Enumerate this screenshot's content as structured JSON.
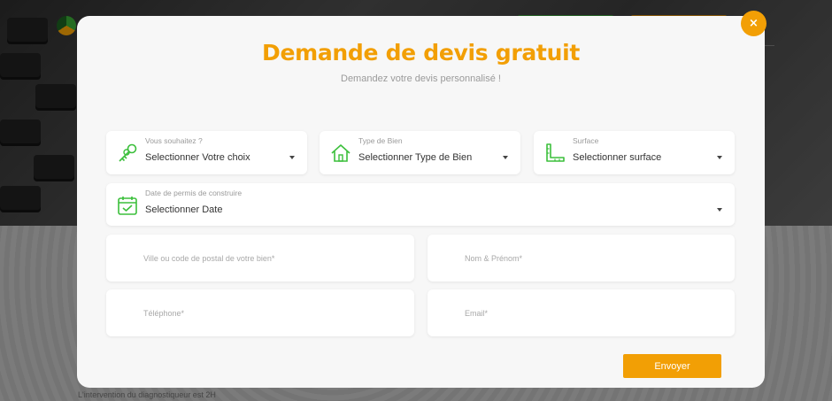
{
  "background": {
    "footer_text": "L'intervention du diagnostiqueur est 2H"
  },
  "modal": {
    "close_label": "×",
    "title": "Demande de devis gratuit",
    "subtitle": "Demandez votre devis personnalisé !",
    "selects": [
      {
        "id": "project",
        "label": "Vous souhaitez ?",
        "value": "Selectionner Votre choix",
        "icon": "keys-icon"
      },
      {
        "id": "property-type",
        "label": "Type de Bien",
        "value": "Selectionner Type de Bien",
        "icon": "house-icon"
      },
      {
        "id": "surface",
        "label": "Surface",
        "value": "Selectionner surface",
        "icon": "ruler-icon"
      },
      {
        "id": "permit-date",
        "label": "Date de permis de construire",
        "value": "Selectionner Date",
        "icon": "calendar-check-icon"
      }
    ],
    "inputs": {
      "city_placeholder": "Ville ou code de postal de votre bien*",
      "name_placeholder": "Nom & Prénom*",
      "phone_placeholder": "Téléphone*",
      "email_placeholder": "Email*"
    },
    "submit_label": "Envoyer"
  },
  "colors": {
    "accent": "#f29f05",
    "icon_green": "#3bbf3b"
  }
}
